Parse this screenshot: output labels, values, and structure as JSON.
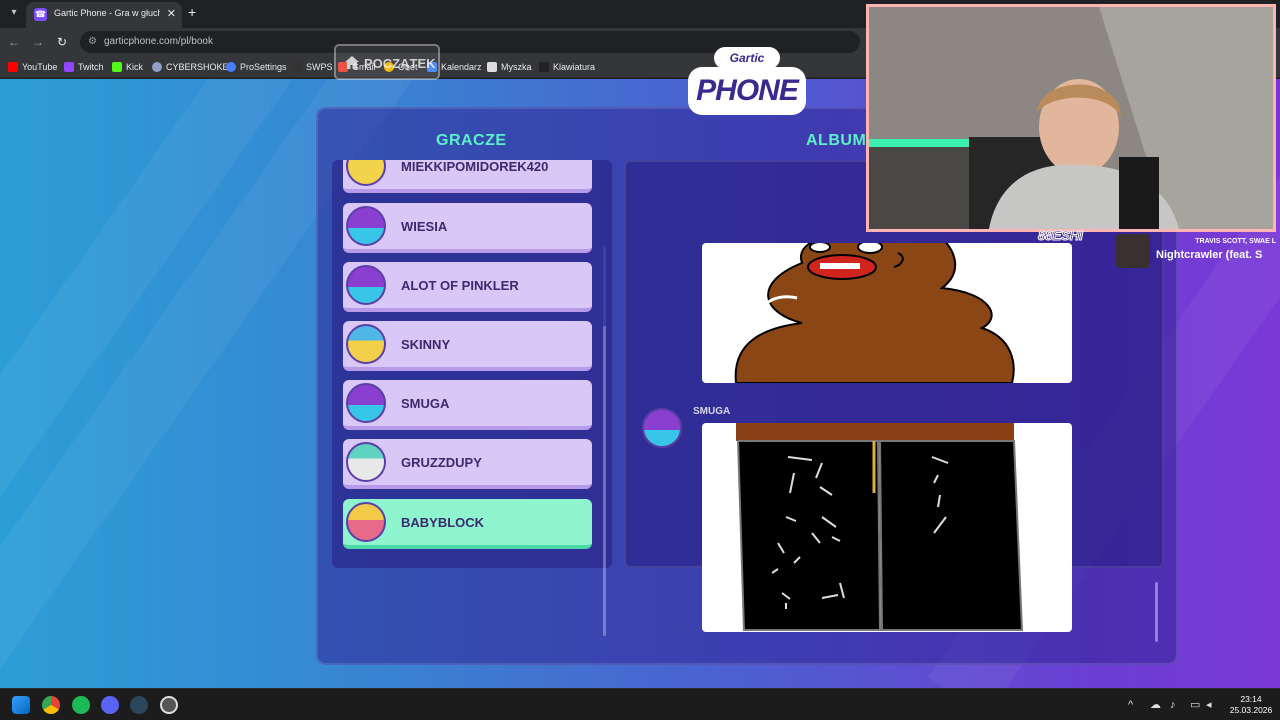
{
  "browser": {
    "tab_title": "Gartic Phone - Gra w głuchy te",
    "url": "garticphone.com/pl/book",
    "bookmarks": [
      "YouTube",
      "Twitch",
      "Kick",
      "CYBERSHOKE",
      "ProSettings",
      "SWPS",
      "Gmail",
      "Onet",
      "Kalendarz",
      "Myszka",
      "Klawiatura"
    ]
  },
  "game": {
    "start_button": "POCZĄTEK",
    "logo_top": "Gartic",
    "logo_bottom": "PHONE",
    "players_heading": "GRACZE",
    "album_heading": "ALBUM",
    "players": [
      {
        "name": "MIEKKIPOMIDOREK420"
      },
      {
        "name": "WIESIA"
      },
      {
        "name": "ALOT OF PINKLER"
      },
      {
        "name": "SKINNY"
      },
      {
        "name": "SMUGA"
      },
      {
        "name": "GRUZZDUPY"
      },
      {
        "name": "BABYBLOCK"
      }
    ],
    "album_author": "SMUGA"
  },
  "stream": {
    "tag": "88ESHI",
    "music_artist": "TRAVIS SCOTT, SWAE L",
    "music_song": "Nightcrawler (feat. S"
  },
  "taskbar": {
    "time": "23:14",
    "date": "25.03.2026"
  },
  "colors": {
    "accent": "#5cf0c8",
    "player_card": "#d9c8f7",
    "player_card_active": "#8ff5cf"
  }
}
